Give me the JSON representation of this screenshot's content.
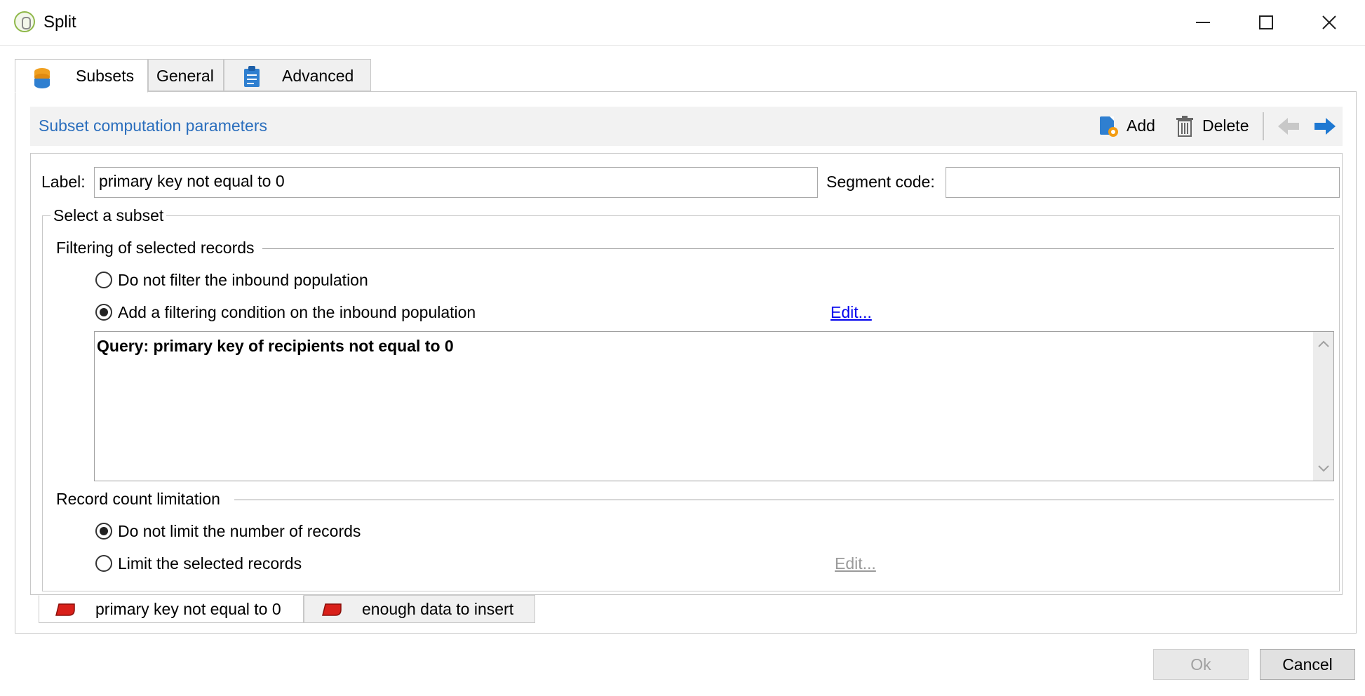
{
  "window": {
    "title": "Split"
  },
  "tabs": [
    {
      "label": "Subsets",
      "icon": "database-icon"
    },
    {
      "label": "General"
    },
    {
      "label": "Advanced",
      "icon": "clipboard-icon"
    }
  ],
  "toolbar": {
    "title": "Subset computation parameters",
    "add_label": "Add",
    "delete_label": "Delete"
  },
  "form": {
    "label_caption": "Label:",
    "label_value": "primary key not equal to 0",
    "segment_caption": "Segment code:",
    "segment_value": ""
  },
  "select_subset": {
    "title": "Select a subset",
    "filtering": {
      "title": "Filtering of selected records",
      "options": [
        {
          "label": "Do not filter the inbound population",
          "selected": false
        },
        {
          "label": "Add a filtering condition on the inbound population",
          "selected": true
        }
      ],
      "edit_label": "Edit...",
      "query_text": "Query: primary key of recipients not equal to 0"
    },
    "limitation": {
      "title": "Record count limitation",
      "options": [
        {
          "label": "Do not limit the number of records",
          "selected": true
        },
        {
          "label": "Limit the selected records",
          "selected": false
        }
      ],
      "edit_label": "Edit..."
    }
  },
  "subset_tabs": [
    {
      "label": "primary key not equal to 0",
      "active": true
    },
    {
      "label": "enough data to insert",
      "active": false
    }
  ],
  "buttons": {
    "ok_label": "Ok",
    "cancel_label": "Cancel"
  },
  "colors": {
    "link_blue": "#2a6ebd",
    "accent_red": "#d9201a",
    "arrow_blue": "#1e78d2"
  }
}
